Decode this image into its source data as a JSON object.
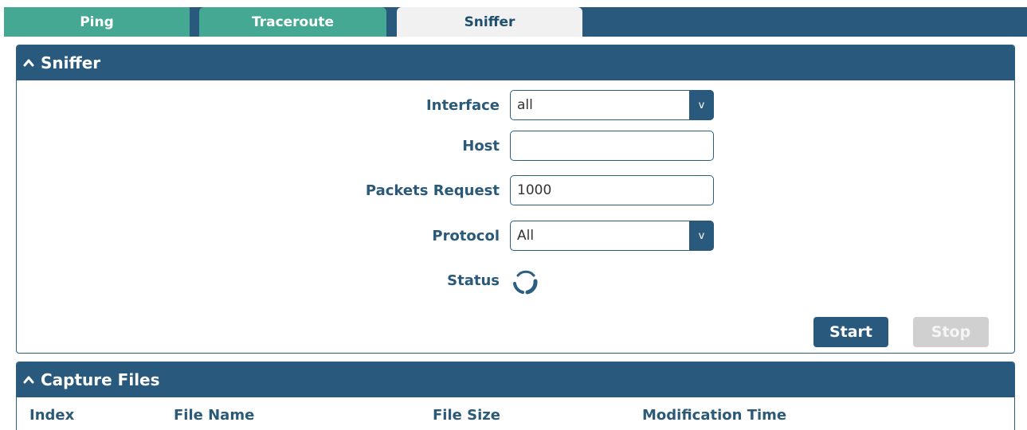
{
  "tabs": [
    {
      "label": "Ping"
    },
    {
      "label": "Traceroute"
    },
    {
      "label": "Sniffer"
    }
  ],
  "sniffer": {
    "title": "Sniffer",
    "interface": {
      "label": "Interface",
      "value": "all"
    },
    "host": {
      "label": "Host",
      "value": ""
    },
    "packets": {
      "label": "Packets Request",
      "value": "1000"
    },
    "protocol": {
      "label": "Protocol",
      "value": "All"
    },
    "status": {
      "label": "Status"
    },
    "start_label": "Start",
    "stop_label": "Stop",
    "dropdown_glyph": "v"
  },
  "capture": {
    "title": "Capture Files",
    "columns": [
      "Index",
      "File Name",
      "File Size",
      "Modification Time"
    ]
  },
  "colors": {
    "header": "#295a7d",
    "tab_inactive": "#45a892",
    "tab_active": "#f1f1f1",
    "label_text": "#2b5a78",
    "button_disabled": "#d0d0d0"
  },
  "icons": {
    "collapse": "chevron-up-icon",
    "status": "loading-spinner-icon",
    "dropdown": "dropdown-arrow-icon"
  }
}
